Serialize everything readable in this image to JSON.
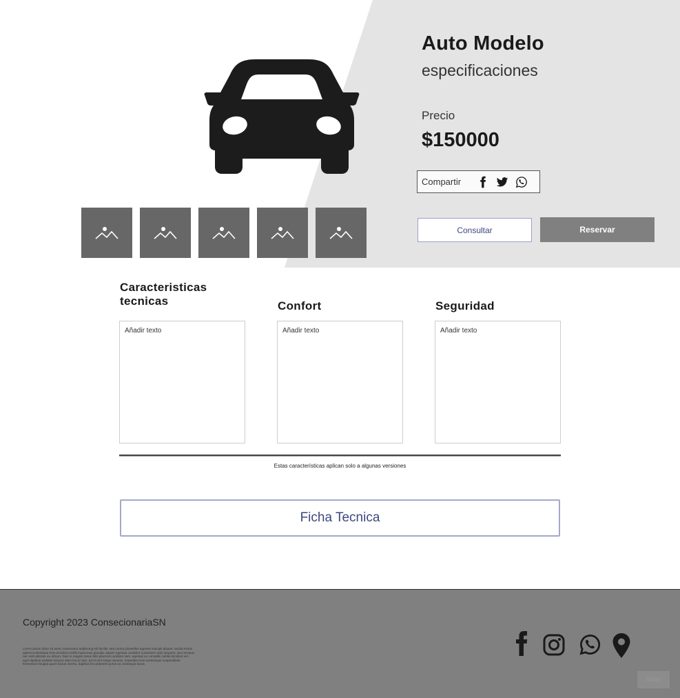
{
  "hero": {
    "title": "Auto Modelo",
    "subtitle": "especificaciones",
    "price_label": "Precio",
    "price": "$150000",
    "car_icon": "car-icon",
    "gallery": [
      {
        "icon": "image-placeholder-icon"
      },
      {
        "icon": "image-placeholder-icon"
      },
      {
        "icon": "image-placeholder-icon"
      },
      {
        "icon": "image-placeholder-icon"
      },
      {
        "icon": "image-placeholder-icon"
      }
    ],
    "share": {
      "label": "Compartir",
      "icons": [
        "facebook-icon",
        "twitter-icon",
        "whatsapp-icon"
      ]
    },
    "buttons": {
      "consultar": "Consultar",
      "reservar": "Reservar"
    }
  },
  "features": {
    "columns": [
      {
        "title": "Caracteristicas tecnicas",
        "placeholder": "Añadir texto"
      },
      {
        "title": "Confort",
        "placeholder": "Añadir texto"
      },
      {
        "title": "Seguridad",
        "placeholder": "Añadir texto"
      }
    ],
    "note": "Estas características aplican solo a algunas versiones",
    "ficha_button": "Ficha Tecnica"
  },
  "footer": {
    "copyright": "Copyright 2023 ConsecionariaSN",
    "lorem": "Lorem ipsum dolor sit amet consectetur adipiscing elit facilisi, sed cursus phasellus egestas suscipit aliquet. Iaculis lectus aptent scelerisque eros tincidunt mollis maecenas gravida, sapien egestas curabitur a praesent odio torquent, arcu tempus nec velit ultricies eu dictum. Duis in magnis netus felis placerat curabitur sem, egestas ac convallis cubilia tincidunt vel, eget dapibus sodales tempus diam lacus nam, ad et sed neque aenean. Imperdiet eros scelerisque suspendisse fermentum feugiat quam luctus viverra, dapibus leo praesent purus ex consequat lacus.",
    "social_icons": [
      "facebook-icon",
      "instagram-icon",
      "whatsapp-icon",
      "location-pin-icon"
    ],
    "badge": "miro"
  },
  "colors": {
    "hero_panel": "#e4e4e4",
    "thumb": "#676767",
    "footer": "#808080",
    "reservar_button": "#808080",
    "accent_text": "#3d4680"
  }
}
